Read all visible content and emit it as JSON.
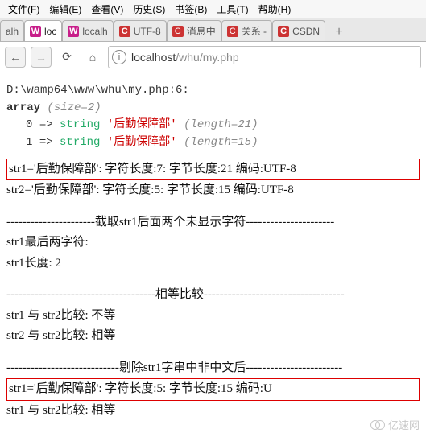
{
  "menu": {
    "file": "文件(F)",
    "edit": "编辑(E)",
    "view": "查看(V)",
    "history": "历史(S)",
    "bookmarks": "书签(B)",
    "tools": "工具(T)",
    "help": "帮助(H)"
  },
  "tabs": [
    {
      "label": "alh",
      "favicon": ""
    },
    {
      "label": "loc",
      "favicon": "W",
      "active": true
    },
    {
      "label": "localh",
      "favicon": "W"
    },
    {
      "label": "UTF-8",
      "favicon": "C"
    },
    {
      "label": "消息中",
      "favicon": "C"
    },
    {
      "label": "关系 -",
      "favicon": "C"
    },
    {
      "label": "CSDN",
      "favicon": "C"
    }
  ],
  "navbar": {
    "back": "←",
    "forward": "→",
    "reload": "⟳",
    "home": "⌂",
    "info": "i",
    "url_host": "localhost",
    "url_path": "/whu/my.php"
  },
  "debug": {
    "path_line": "D:\\wamp64\\www\\whu\\my.php:6:",
    "array_kw": "array",
    "size_text": "(size=2)",
    "row0_idx": "0",
    "row0_arrow": "=>",
    "row0_type": "string",
    "row0_val": "'后勤保障部'",
    "row0_len": "(length=21)",
    "row1_idx": "1",
    "row1_arrow": "=>",
    "row1_type": "string",
    "row1_val": "'后勤保障部'",
    "row1_len": "(length=15)"
  },
  "lines": {
    "str1_info": "str1='后勤保障部':    字符长度:7:    字节长度:21    编码:UTF-8",
    "str2_info": "str2='后勤保障部':    字符长度:5:    字节长度:15    编码:UTF-8",
    "sep1": "----------------------截取str1后面两个未显示字符----------------------",
    "last2_label": "str1最后两字符:",
    "len_label": "str1长度:   2",
    "sep2": "-------------------------------------相等比较-----------------------------------",
    "cmp1": "str1 与 str2比较:   不等",
    "cmp2": "str2 与 str2比较:   相等",
    "sep3": "----------------------------剔除str1字串中非中文后------------------------",
    "str1_after": "str1='后勤保障部':    字符长度:5:    字节长度:15    编码:U",
    "cmp3": "str1 与 str2比较:   相等"
  },
  "watermark": "亿速网"
}
